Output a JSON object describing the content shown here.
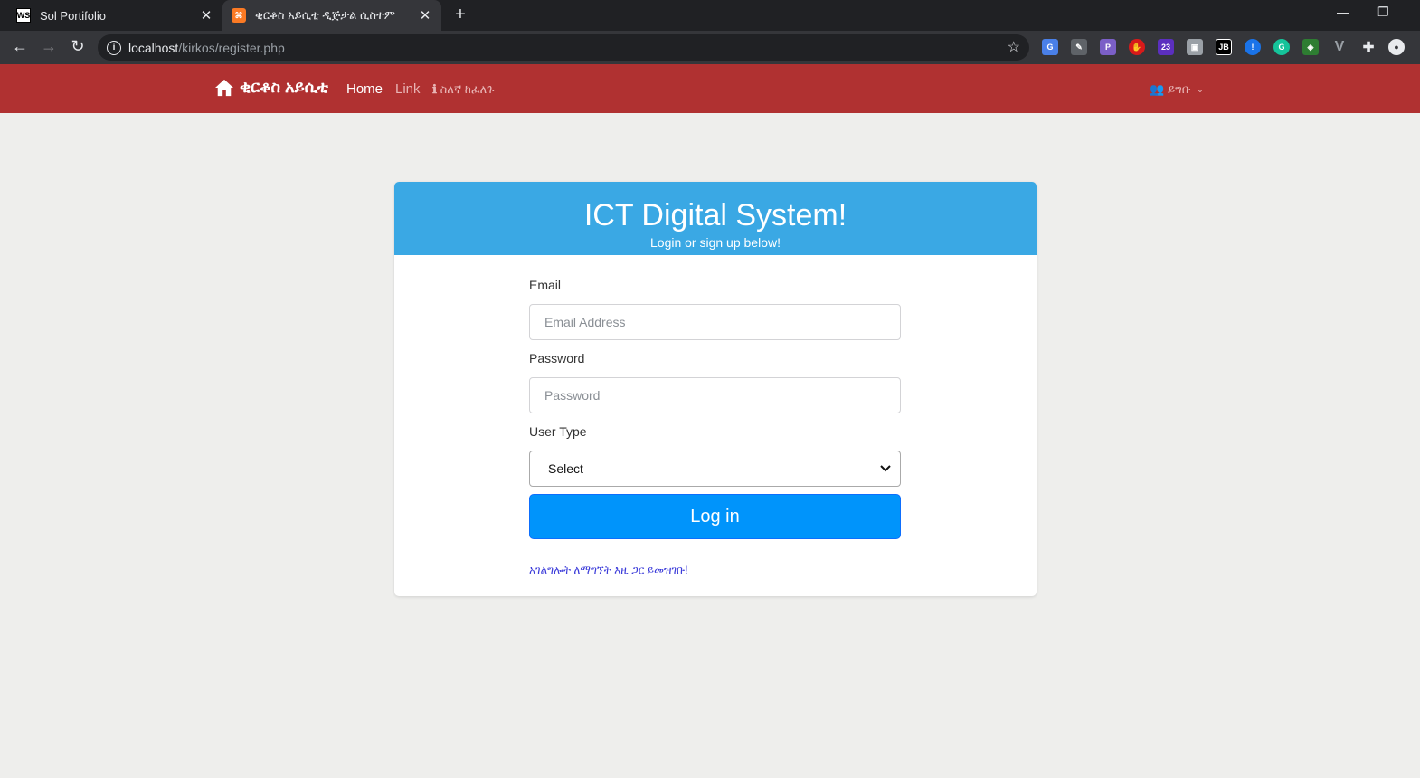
{
  "browser": {
    "tabs": [
      {
        "title": "Sol Portifolio",
        "favicon": "WS",
        "active": false
      },
      {
        "title": "ቂርቆስ አይሲቲ ዲጅታል ሲስተም",
        "favicon": "⌘",
        "active": true
      }
    ],
    "url_host": "localhost",
    "url_path": "/kirkos/register.php"
  },
  "navbar": {
    "brand": "ቂርቆስ አይሲቲ",
    "home": "Home",
    "link": "Link",
    "about": "ስለኛ ከፈለጉ",
    "account": "ይግቡ",
    "color": "#b03131"
  },
  "card": {
    "title": "ICT Digital System!",
    "subtitle": "Login or sign up below!",
    "header_color": "#3aa8e4"
  },
  "form": {
    "email_label": "Email",
    "email_placeholder": "Email Address",
    "password_label": "Password",
    "password_placeholder": "Password",
    "usertype_label": "User Type",
    "usertype_value": "Select",
    "login_button": "Log in",
    "register_link": "አገልግሎት ለማግኘት እዚ ጋር ይመዝገቡ!"
  }
}
